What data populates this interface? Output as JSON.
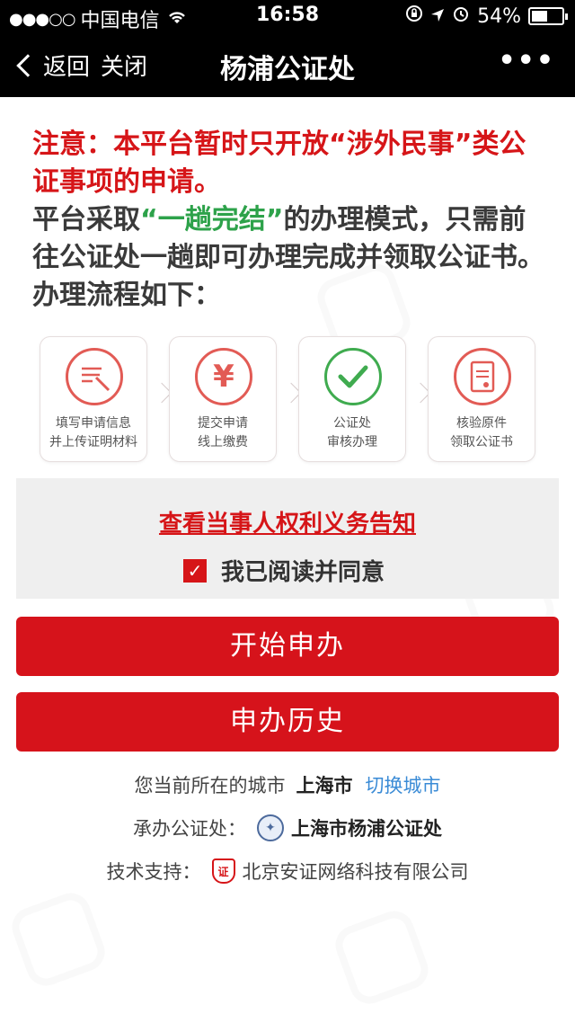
{
  "status_bar": {
    "signal": "●●●○○",
    "carrier": "中国电信",
    "time": "16:58",
    "battery_percent": "54%",
    "battery_level": 0.54
  },
  "nav": {
    "back_label": "返回",
    "close_label": "关闭",
    "title": "杨浦公证处"
  },
  "notice": {
    "warning_prefix": "注意：本平台暂时只开放",
    "warning_quote": "“涉外民事”",
    "warning_suffix": "类公证事项的申请。",
    "body_prefix": "平台采取",
    "body_highlight": "“一趟完结”",
    "body_suffix": "的办理模式，只需前往公证处一趟即可办理完成并领取公证书。办理流程如下："
  },
  "steps": [
    {
      "line1": "填写申请信息",
      "line2": "并上传证明材料",
      "icon": "pen-form-icon"
    },
    {
      "line1": "提交申请",
      "line2": "线上缴费",
      "icon": "yen-icon"
    },
    {
      "line1": "公证处",
      "line2": "审核办理",
      "icon": "checkmark-icon"
    },
    {
      "line1": "核验原件",
      "line2": "领取公证书",
      "icon": "certificate-icon"
    }
  ],
  "agreement": {
    "link_text": "查看当事人权利义务告知",
    "check_label": "我已阅读并同意",
    "checked": true
  },
  "buttons": {
    "start": "开始申办",
    "history": "申办历史"
  },
  "footer": {
    "city_label": "您当前所在的城市",
    "city_value": "上海市",
    "switch_city": "切换城市",
    "office_label": "承办公证处：",
    "office_value": "上海市杨浦公证处",
    "support_label": "技术支持：",
    "support_value": "北京安证网络科技有限公司"
  },
  "colors": {
    "accent_red": "#d6131b",
    "green": "#2da24a",
    "link_blue": "#3a8bd6"
  }
}
